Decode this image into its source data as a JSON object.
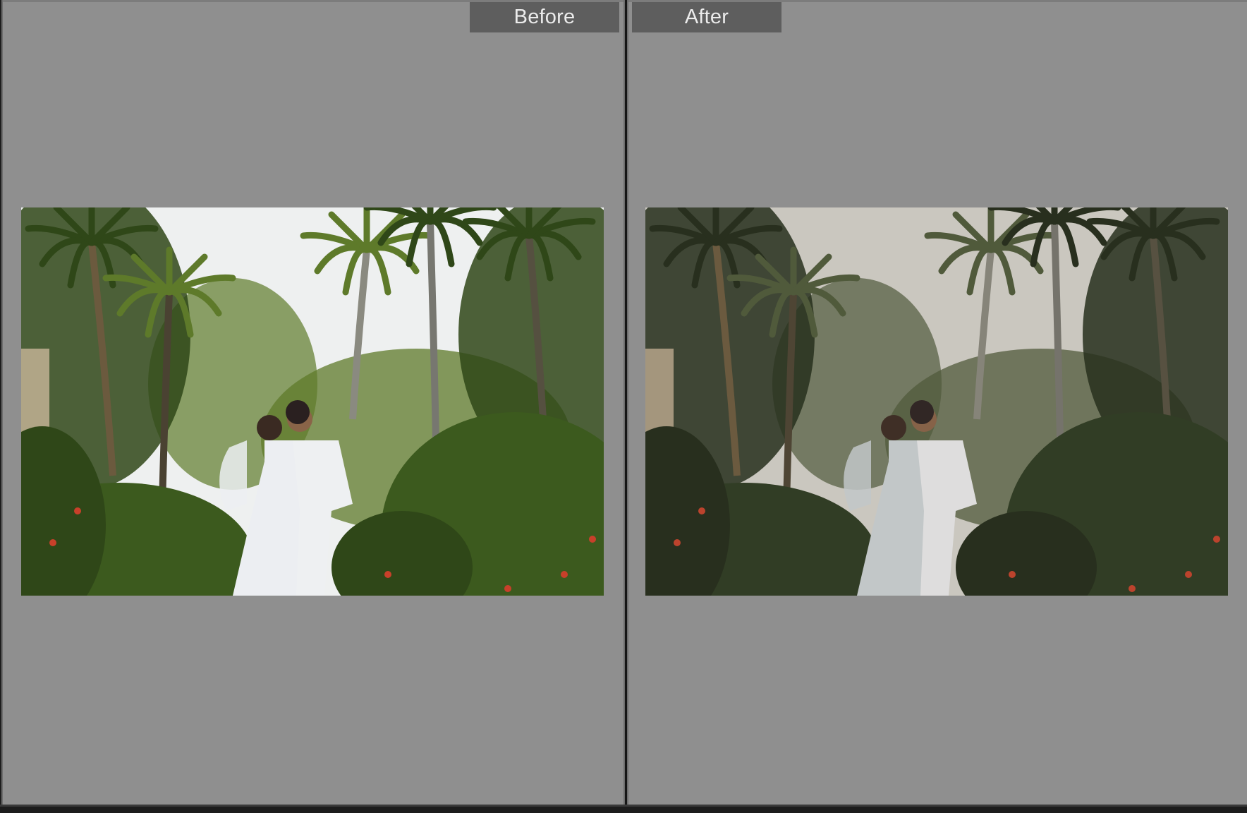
{
  "compare_view": {
    "before_label": "Before",
    "after_label": "After"
  },
  "photo": {
    "subject": "wedding-couple-kissing-among-palm-trees",
    "before_tone": {
      "sky": "#eef0f0",
      "foliage": "#5e7a2a",
      "foliage_dark": "#2f4718",
      "hedge": "#3c5a1e",
      "dress": "#eceef2"
    },
    "after_tone": {
      "sky": "#d8d6d0",
      "foliage": "#4d5a3a",
      "foliage_dark": "#1f2a18",
      "hedge": "#2a3a20",
      "dress": "#cfd6da"
    }
  },
  "colors": {
    "pane_background": "#8f8f8f",
    "label_background": "#5e5e5e",
    "label_text": "#ececec",
    "divider": "#161616"
  }
}
